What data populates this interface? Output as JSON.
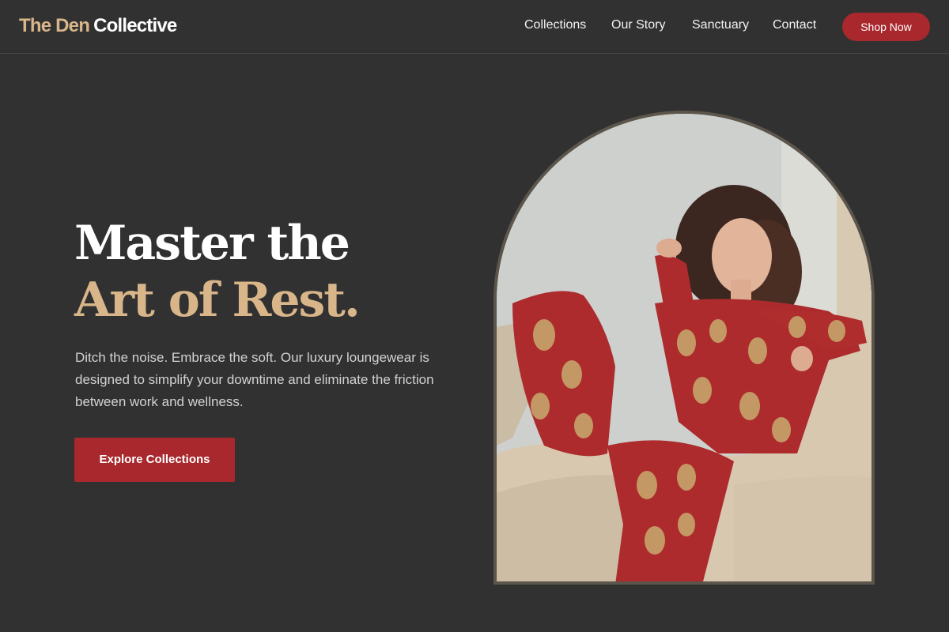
{
  "brand": {
    "name_part1": "The Den",
    "name_part2": "Collective"
  },
  "nav": {
    "items": [
      {
        "label": "Collections"
      },
      {
        "label": "Our Story"
      },
      {
        "label": "Sanctuary"
      },
      {
        "label": "Contact"
      }
    ],
    "shop_button": "Shop Now"
  },
  "hero": {
    "headline_line1": "Master the",
    "headline_line2": "Art of Rest.",
    "subtext": "Ditch the noise. Embrace the soft. Our luxury loungewear is designed to simplify your downtime and eliminate the friction between work and wellness.",
    "cta_label": "Explore Collections"
  },
  "colors": {
    "background": "#313131",
    "accent_gold": "#d9b58a",
    "brand_red": "#a8282d",
    "arch_border": "#5c554b"
  }
}
